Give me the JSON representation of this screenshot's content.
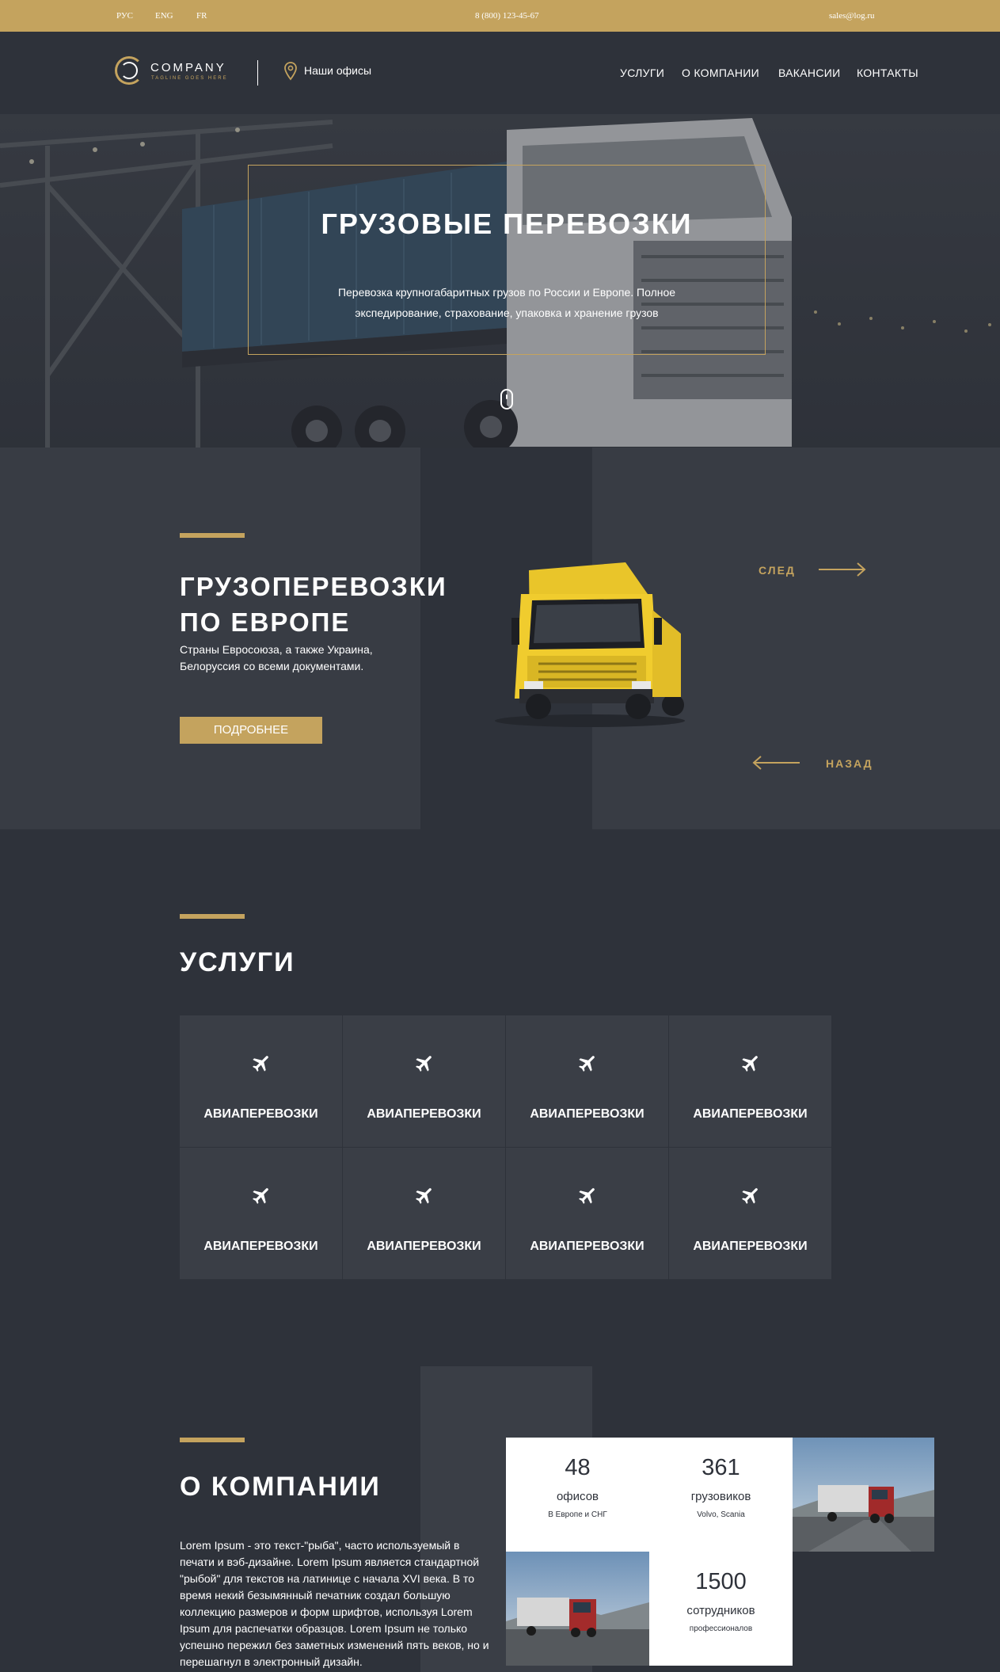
{
  "topbar": {
    "langs": [
      "РУС",
      "ENG",
      "FR"
    ],
    "phone": "8 (800) 123-45-67",
    "email": "sales@log.ru"
  },
  "header": {
    "logo_name": "COMPANY",
    "logo_tagline": "TAGLINE GOES HERE",
    "offices_label": "Наши офисы",
    "nav": [
      "УСЛУГИ",
      "О КОМПАНИИ",
      "ВАКАНСИИ",
      "КОНТАКТЫ"
    ]
  },
  "hero": {
    "title": "ГРУЗОВЫЕ ПЕРЕВОЗКИ",
    "subtitle": "Перевозка крупногабаритных грузов по России и Европе. Полное экспедирование, страхование, упаковка и хранение грузов"
  },
  "slider": {
    "title_line1": "ГРУЗОПЕРЕВОЗКИ",
    "title_line2": "ПО ЕВРОПЕ",
    "description": "Страны Евросоюза, а также Украина, Белоруссия со всеми документами.",
    "button": "ПОДРОБНЕЕ",
    "next": "СЛЕД",
    "prev": "НАЗАД"
  },
  "services": {
    "title": "УСЛУГИ",
    "items": [
      "АВИАПЕРЕВОЗКИ",
      "АВИАПЕРЕВОЗКИ",
      "АВИАПЕРЕВОЗКИ",
      "АВИАПЕРЕВОЗКИ",
      "АВИАПЕРЕВОЗКИ",
      "АВИАПЕРЕВОЗКИ",
      "АВИАПЕРЕВОЗКИ",
      "АВИАПЕРЕВОЗКИ"
    ],
    "icon": "airplane-icon"
  },
  "about": {
    "title": "О КОМПАНИИ",
    "text": "Lorem Ipsum - это текст-\"рыба\", часто используемый в печати и вэб-дизайне. Lorem Ipsum является стандартной \"рыбой\" для текстов на латинице с начала XVI века. В то время некий безымянный печатник создал большую коллекцию размеров и форм шрифтов, используя Lorem Ipsum для распечатки образцов. Lorem Ipsum не только успешно пережил без заметных изменений пять веков, но и перешагнул в электронный дизайн.",
    "stats": [
      {
        "number": "48",
        "label": "офисов",
        "sub": "В Европе и СНГ"
      },
      {
        "number": "361",
        "label": "грузовиков",
        "sub": "Volvo, Scania"
      },
      {
        "number": "1500",
        "label": "сотрудников",
        "sub": "профессионалов"
      }
    ]
  },
  "colors": {
    "accent": "#c4a35e",
    "background": "#2e323a",
    "panel": "#383c44"
  }
}
